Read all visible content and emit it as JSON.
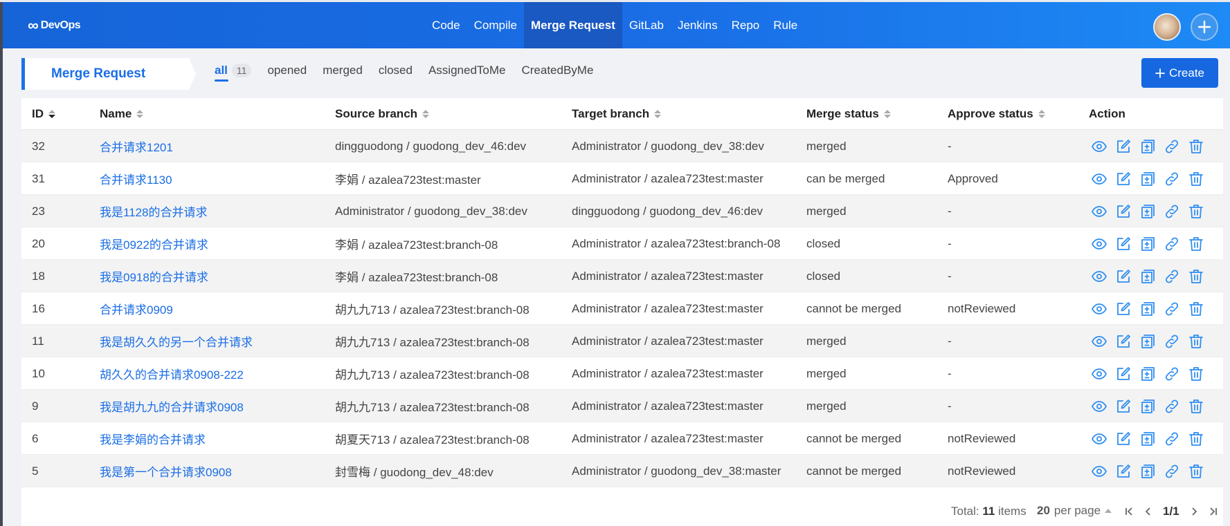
{
  "app": {
    "logo_symbol": "∞",
    "logo_text": "DevOps",
    "nav": [
      {
        "label": "Code",
        "active": false
      },
      {
        "label": "Compile",
        "active": false
      },
      {
        "label": "Merge Request",
        "active": true
      },
      {
        "label": "GitLab",
        "active": false
      },
      {
        "label": "Jenkins",
        "active": false
      },
      {
        "label": "Repo",
        "active": false
      },
      {
        "label": "Rule",
        "active": false
      }
    ],
    "accent_color": "#1a6ee6"
  },
  "page": {
    "title": "Merge Request",
    "tabs": [
      {
        "label": "all",
        "count": "11",
        "active": true
      },
      {
        "label": "opened"
      },
      {
        "label": "merged"
      },
      {
        "label": "closed"
      },
      {
        "label": "AssignedToMe"
      },
      {
        "label": "CreatedByMe"
      }
    ],
    "create_label": "Create"
  },
  "table": {
    "columns": [
      "ID",
      "Name",
      "Source branch",
      "Target branch",
      "Merge status",
      "Approve status",
      "Action"
    ],
    "rows": [
      {
        "id": "32",
        "name": "合并请求1201",
        "source": "dingguodong / guodong_dev_46:dev",
        "target": "Administrator / guodong_dev_38:dev",
        "merge": "merged",
        "approve": "-"
      },
      {
        "id": "31",
        "name": "合并请求1130",
        "source": "李娟 / azalea723test:master",
        "target": "Administrator / azalea723test:master",
        "merge": "can be merged",
        "approve": "Approved"
      },
      {
        "id": "23",
        "name": "我是1128的合并请求",
        "source": "Administrator / guodong_dev_38:dev",
        "target": "dingguodong / guodong_dev_46:dev",
        "merge": "merged",
        "approve": "-"
      },
      {
        "id": "20",
        "name": "我是0922的合并请求",
        "source": "李娟 / azalea723test:branch-08",
        "target": "Administrator / azalea723test:branch-08",
        "merge": "closed",
        "approve": "-"
      },
      {
        "id": "18",
        "name": "我是0918的合并请求",
        "source": "李娟 / azalea723test:branch-08",
        "target": "Administrator / azalea723test:master",
        "merge": "closed",
        "approve": "-"
      },
      {
        "id": "16",
        "name": "合并请求0909",
        "source": "胡九九713 / azalea723test:branch-08",
        "target": "Administrator / azalea723test:master",
        "merge": "cannot be merged",
        "approve": "notReviewed"
      },
      {
        "id": "11",
        "name": "我是胡久久的另一个合并请求",
        "source": "胡九九713 / azalea723test:branch-08",
        "target": "Administrator / azalea723test:master",
        "merge": "merged",
        "approve": "-"
      },
      {
        "id": "10",
        "name": "胡久久的合并请求0908-222",
        "source": "胡九九713 / azalea723test:branch-08",
        "target": "Administrator / azalea723test:master",
        "merge": "merged",
        "approve": "-"
      },
      {
        "id": "9",
        "name": "我是胡九九的合并请求0908",
        "source": "胡九九713 / azalea723test:branch-08",
        "target": "Administrator / azalea723test:master",
        "merge": "merged",
        "approve": "-"
      },
      {
        "id": "6",
        "name": "我是李娟的合并请求",
        "source": "胡夏天713 / azalea723test:branch-08",
        "target": "Administrator / azalea723test:master",
        "merge": "cannot be merged",
        "approve": "notReviewed"
      },
      {
        "id": "5",
        "name": "我是第一个合并请求0908",
        "source": "封雪梅 / guodong_dev_48:dev",
        "target": "Administrator / guodong_dev_38:master",
        "merge": "cannot be merged",
        "approve": "notReviewed"
      }
    ],
    "action_icons": [
      "eye-icon",
      "edit-icon",
      "review-icon",
      "link-icon",
      "trash-icon"
    ]
  },
  "pagination": {
    "total_prefix": "Total:",
    "total_count": "11",
    "total_suffix": "items",
    "per_page_count": "20",
    "per_page_label": "per page",
    "page_indicator": "1/1"
  }
}
